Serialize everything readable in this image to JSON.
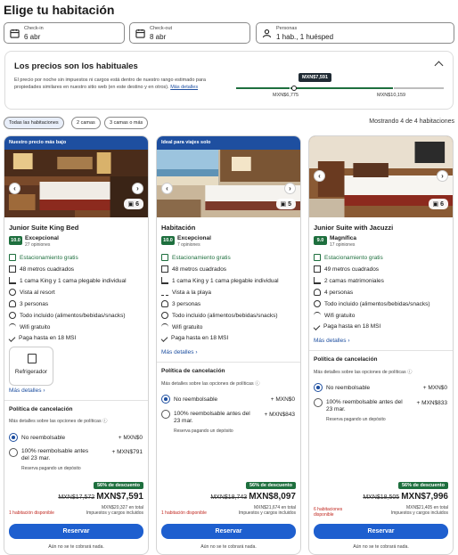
{
  "page": {
    "title": "Elige tu habitación"
  },
  "search": {
    "checkin": {
      "label": "Check-in",
      "value": "6 abr"
    },
    "checkout": {
      "label": "Check-out",
      "value": "8 abr"
    },
    "guests": {
      "label": "Personas",
      "value": "1 hab., 1 huésped"
    }
  },
  "price_panel": {
    "title": "Los precios son los habituales",
    "description": "El precio por noche sin impuestos ni cargos está dentro de nuestro rango estimado para propiedades similares en nuestro sitio web (en este destino y en otros).",
    "details_link": "Más detalles",
    "current_price": "MXN$7,591",
    "range_low": "MXN$6,775",
    "range_high": "MXN$10,159",
    "marker_fraction": 0.28
  },
  "filters": {
    "chips": [
      "Todas las habitaciones",
      "2 camas",
      "3 camas o más"
    ],
    "selected": "Todas las habitaciones",
    "showing": "Mostrando 4 de 4 habitaciones"
  },
  "colors": {
    "accent": "#1e4fa0",
    "button": "#1e5fcf",
    "rating": "#1e6f3e",
    "discount": "#1e6f3e",
    "alert": "#c0271f"
  },
  "rooms": [
    {
      "banner": "Nuestro precio más bajo",
      "photo_count": "6",
      "name": "Junior Suite King Bed",
      "rating": "10.0",
      "rating_word": "Excepcional",
      "reviews": "27 opiniones",
      "features": [
        {
          "icon": "parking-icon",
          "text": "Estacionamiento gratis",
          "green": true
        },
        {
          "icon": "size-icon",
          "text": "48 metros cuadrados"
        },
        {
          "icon": "bed-icon",
          "text": "1 cama King y 1 cama plegable individual"
        },
        {
          "icon": "view-icon",
          "text": "Vista al resort"
        },
        {
          "icon": "people-icon",
          "text": "3 personas"
        },
        {
          "icon": "all-inclusive-icon",
          "text": "Todo incluido (alimentos/bebidas/snacks)"
        },
        {
          "icon": "wifi-icon",
          "text": "Wifi gratuito"
        },
        {
          "icon": "check-icon",
          "text": "Paga hasta en 18 MSI"
        }
      ],
      "amenity_tile": "Refrigerador",
      "more": "Más detalles",
      "policy_title": "Política de cancelación",
      "policy_sub": "Más detalles sobre las opciones de políticas",
      "option1": {
        "label": "No reembolsable",
        "price": "+ MXN$0"
      },
      "option2": {
        "label": "100% reembolsable antes del 23 mar.",
        "price": "+ MXN$791",
        "sub": "Reserva pagando un depósito"
      },
      "discount": "56% de descuento",
      "old_price": "MXN$17,572",
      "price": "MXN$7,591",
      "total": "MXN$20,327 en total",
      "taxes": "Impuestos y cargos incluidos",
      "availability": "1 habitación disponible",
      "button": "Reservar",
      "note": "Aún no se te cobrará nada."
    },
    {
      "banner": "Ideal para viajes solo",
      "photo_count": "5",
      "name": "Habitación",
      "rating": "10.0",
      "rating_word": "Excepcional",
      "reviews": "7 opiniones",
      "features": [
        {
          "icon": "parking-icon",
          "text": "Estacionamiento gratis",
          "green": true
        },
        {
          "icon": "size-icon",
          "text": "48 metros cuadrados"
        },
        {
          "icon": "bed-icon",
          "text": "1 cama King y 1 cama plegable individual"
        },
        {
          "icon": "beach-icon",
          "text": "Vista a la playa"
        },
        {
          "icon": "people-icon",
          "text": "3 personas"
        },
        {
          "icon": "all-inclusive-icon",
          "text": "Todo incluido (alimentos/bebidas/snacks)"
        },
        {
          "icon": "wifi-icon",
          "text": "Wifi gratuito"
        },
        {
          "icon": "check-icon",
          "text": "Paga hasta en 18 MSI"
        }
      ],
      "more": "Más detalles",
      "policy_title": "Política de cancelación",
      "policy_sub": "Más detalles sobre las opciones de políticas",
      "option1": {
        "label": "No reembolsable",
        "price": "+ MXN$0"
      },
      "option2": {
        "label": "100% reembolsable antes del 23 mar.",
        "price": "+ MXN$843",
        "sub": "Reserva pagando un depósito"
      },
      "discount": "56% de descuento",
      "old_price": "MXN$18,743",
      "price": "MXN$8,097",
      "total": "MXN$21,674 en total",
      "taxes": "Impuestos y cargos incluidos",
      "availability": "1 habitación disponible",
      "button": "Reservar",
      "note": "Aún no se te cobrará nada."
    },
    {
      "banner": "",
      "photo_count": "6",
      "name": "Junior Suite with Jacuzzi",
      "rating": "9.0",
      "rating_word": "Magnífica",
      "reviews": "17 opiniones",
      "features": [
        {
          "icon": "parking-icon",
          "text": "Estacionamiento gratis",
          "green": true
        },
        {
          "icon": "size-icon",
          "text": "49 metros cuadrados"
        },
        {
          "icon": "bed-icon",
          "text": "2 camas matrimoniales"
        },
        {
          "icon": "people-icon",
          "text": "4 personas"
        },
        {
          "icon": "all-inclusive-icon",
          "text": "Todo incluido (alimentos/bebidas/snacks)"
        },
        {
          "icon": "wifi-icon",
          "text": "Wifi gratuito"
        },
        {
          "icon": "check-icon",
          "text": "Paga hasta en 18 MSI"
        }
      ],
      "more": "Más detalles",
      "policy_title": "Política de cancelación",
      "policy_sub": "Más detalles sobre las opciones de políticas",
      "option1": {
        "label": "No reembolsable",
        "price": "+ MXN$0"
      },
      "option2": {
        "label": "100% reembolsable antes del 23 mar.",
        "price": "+ MXN$833",
        "sub": "Reserva pagando un depósito"
      },
      "discount": "56% de descuento",
      "old_price": "MXN$18,505",
      "price": "MXN$7,996",
      "total": "MXN$21,405 en total",
      "taxes": "Impuestos y cargos incluidos",
      "availability": "6 habitaciones disponible",
      "button": "Reservar",
      "note": "Aún no se te cobrará nada."
    }
  ]
}
